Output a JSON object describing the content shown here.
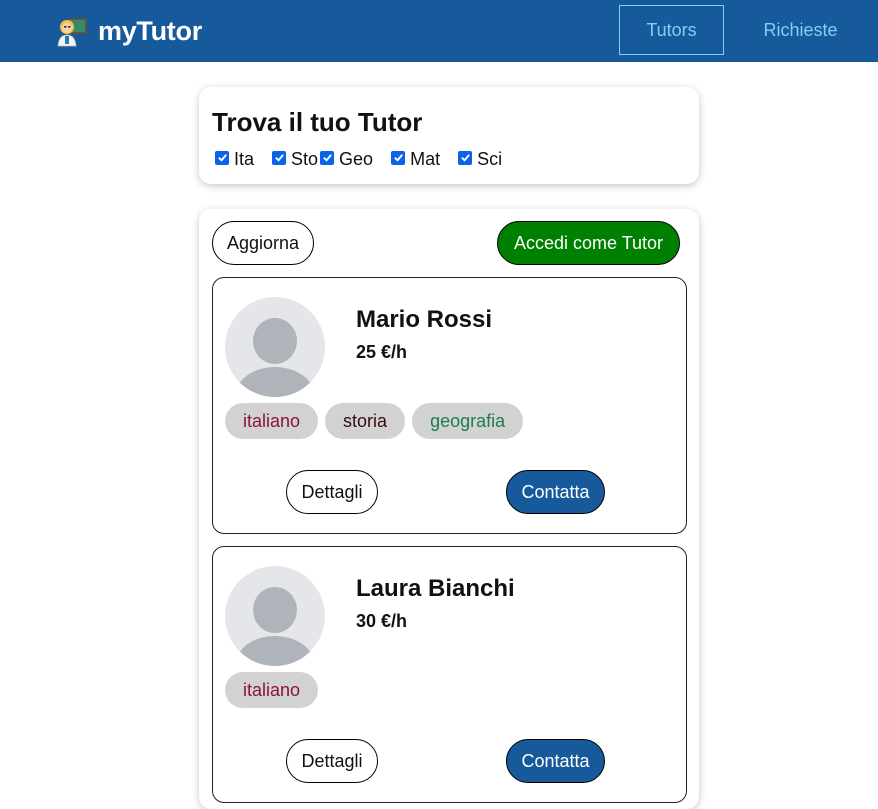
{
  "navbar": {
    "brand": "myTutor",
    "brand_icon": "teacher-emoji-icon",
    "links": [
      {
        "label": "Tutors",
        "active": true
      },
      {
        "label": "Richieste",
        "active": false
      }
    ],
    "colors": {
      "background": "#175a9b",
      "link": "#7fd0f5"
    }
  },
  "filter": {
    "title": "Trova il tuo Tutor",
    "options": [
      {
        "label": "Ita",
        "checked": true
      },
      {
        "label": "Sto",
        "checked": true
      },
      {
        "label": "Geo",
        "checked": true
      },
      {
        "label": "Mat",
        "checked": true
      },
      {
        "label": "Sci",
        "checked": true
      }
    ]
  },
  "actions": {
    "refresh_label": "Aggiorna",
    "login_label": "Accedi come Tutor",
    "login_color": "#008000"
  },
  "tutors": [
    {
      "name": "Mario Rossi",
      "price": "25 €/h",
      "tags": [
        {
          "label": "italiano",
          "color": "#8b1538"
        },
        {
          "label": "storia",
          "color": "#3a0d12"
        },
        {
          "label": "geografia",
          "color": "#1e7d4e"
        }
      ],
      "details_label": "Dettagli",
      "contact_label": "Contatta"
    },
    {
      "name": "Laura Bianchi",
      "price": "30 €/h",
      "tags": [
        {
          "label": "italiano",
          "color": "#8b1538"
        }
      ],
      "details_label": "Dettagli",
      "contact_label": "Contatta"
    }
  ]
}
